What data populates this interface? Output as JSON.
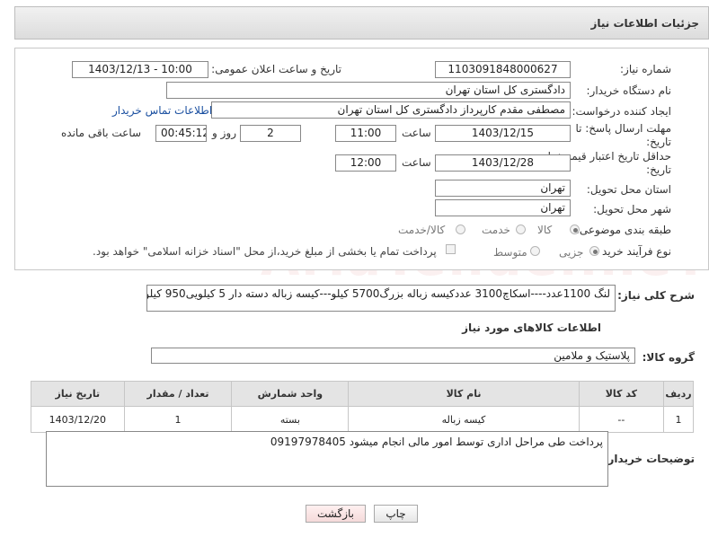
{
  "header": {
    "title": "جزئیات اطلاعات نیاز"
  },
  "form": {
    "need_number_label": "شماره نیاز:",
    "need_number": "1103091848000627",
    "announce_label": "تاریخ و ساعت اعلان عمومی:",
    "announce_value": "1403/12/13 - 10:00",
    "buyer_org_label": "نام دستگاه خریدار:",
    "buyer_org": "دادگستری کل استان تهران",
    "requester_label": "ایجاد کننده درخواست:",
    "requester": "مصطفی مقدم کارپرداز دادگستری کل استان تهران",
    "contact_link": "اطلاعات تماس خریدار",
    "deadline_label_1": "مهلت ارسال پاسخ: تا",
    "deadline_label_2": "تاریخ:",
    "deadline_date": "1403/12/15",
    "time_word": "ساعت",
    "deadline_time": "11:00",
    "days_value": "2",
    "days_word": "روز و",
    "remaining_time": "00:45:12",
    "remaining_word": "ساعت باقی مانده",
    "price_validity_label_1": "حداقل تاریخ اعتبار قیمت: تا",
    "price_validity_label_2": "تاریخ:",
    "price_validity_date": "1403/12/28",
    "price_validity_time": "12:00",
    "province_label": "استان محل تحویل:",
    "province": "تهران",
    "city_label": "شهر محل تحویل:",
    "city": "تهران",
    "category_label": "طبقه بندی موضوعی:",
    "category_options": [
      "کالا",
      "خدمت",
      "کالا/خدمت"
    ],
    "category_selected": "کالا",
    "process_label": "نوع فرآیند خرید :",
    "process_options": [
      "جزیی",
      "متوسط"
    ],
    "process_selected": "جزیی",
    "payment_note": "پرداخت تمام یا بخشی از مبلغ خرید،از محل \"اسناد خزانه اسلامی\" خواهد بود."
  },
  "description": {
    "label": "شرح کلی نیاز:",
    "text": "لنگ 1100عدد----اسکاچ3100 عددکیسه زباله بزرگ5700 کیلو---کیسه زباله دسته دار 5 کیلویی950 کیلو"
  },
  "goods_section": {
    "title": "اطلاعات کالاهای مورد نیاز",
    "group_label": "گروه کالا:",
    "group_value": "پلاستیک و ملامین"
  },
  "table": {
    "headers": [
      "ردیف",
      "کد کالا",
      "نام کالا",
      "واحد شمارش",
      "تعداد / مقدار",
      "تاریخ نیاز"
    ],
    "rows": [
      [
        "1",
        "--",
        "کیسه زباله",
        "بسته",
        "1",
        "1403/12/20"
      ]
    ]
  },
  "buyer_notes": {
    "label": "توضیحات خریدار:",
    "text": "پرداخت طی مراحل اداری توسط امور مالی انجام  میشود 09197978405"
  },
  "buttons": {
    "print": "چاپ",
    "back": "بازگشت"
  },
  "watermark": "AriaTender.neT"
}
